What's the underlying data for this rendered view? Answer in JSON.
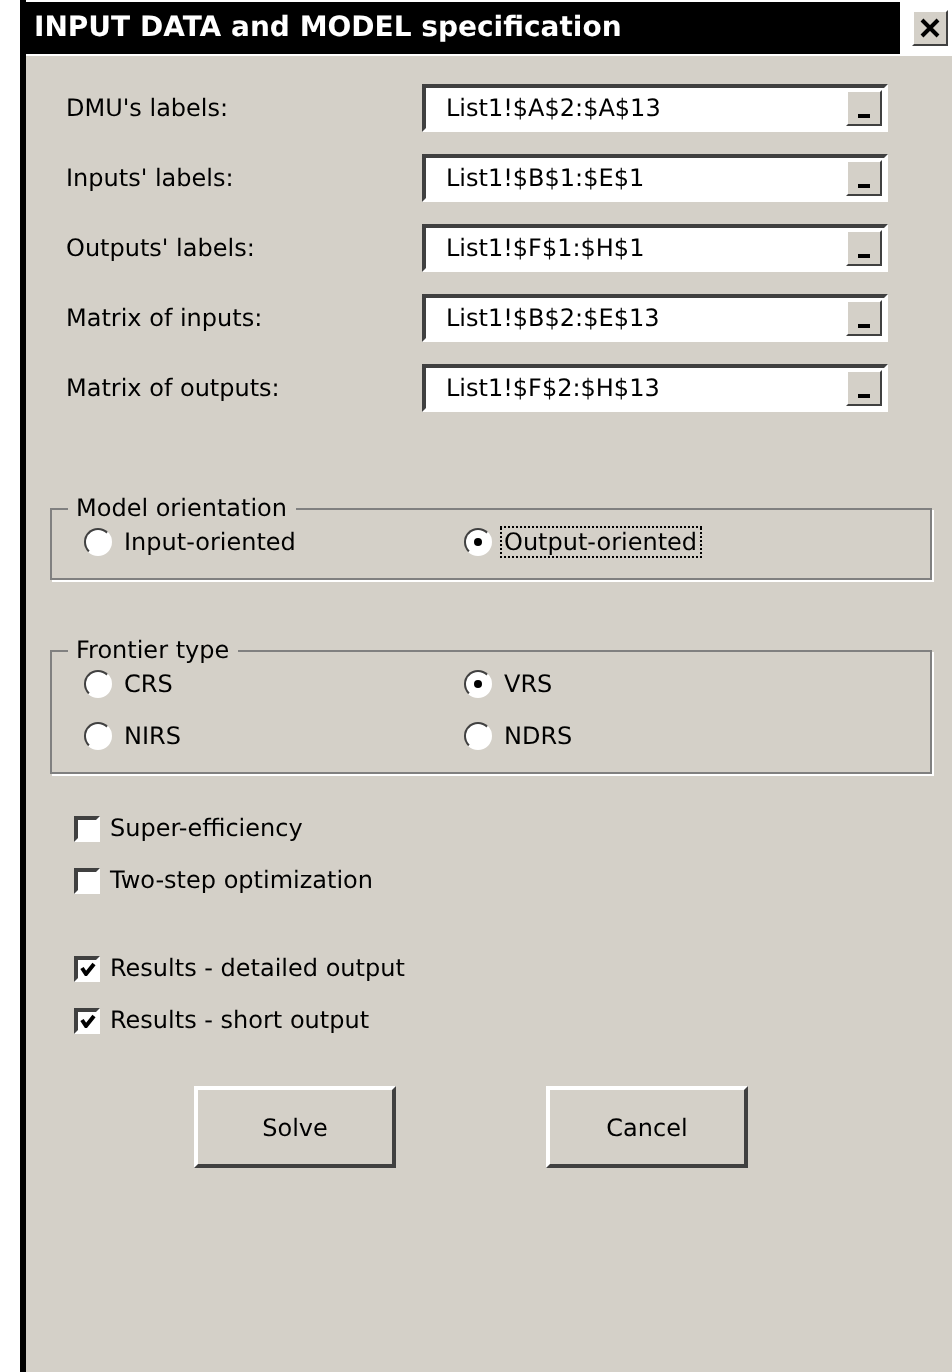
{
  "window": {
    "title": "INPUT DATA and MODEL specification"
  },
  "fields": [
    {
      "label": "DMU's labels:",
      "value": "List1!$A$2:$A$13"
    },
    {
      "label": "Inputs' labels:",
      "value": "List1!$B$1:$E$1"
    },
    {
      "label": "Outputs' labels:",
      "value": "List1!$F$1:$H$1"
    },
    {
      "label": "Matrix of inputs:",
      "value": "List1!$B$2:$E$13"
    },
    {
      "label": "Matrix of outputs:",
      "value": "List1!$F$2:$H$13"
    }
  ],
  "groups": [
    {
      "title": "Model orientation",
      "options": [
        {
          "label": "Input-oriented",
          "selected": false,
          "focused": false
        },
        {
          "label": "Output-oriented",
          "selected": true,
          "focused": true
        }
      ]
    },
    {
      "title": "Frontier type",
      "options": [
        {
          "label": "CRS",
          "selected": false,
          "focused": false
        },
        {
          "label": "VRS",
          "selected": true,
          "focused": false
        },
        {
          "label": "NIRS",
          "selected": false,
          "focused": false
        },
        {
          "label": "NDRS",
          "selected": false,
          "focused": false
        }
      ]
    }
  ],
  "checkbox_groups": [
    [
      {
        "label": "Super-efficiency",
        "checked": false
      },
      {
        "label": "Two-step optimization",
        "checked": false
      }
    ],
    [
      {
        "label": "Results - detailed output",
        "checked": true
      },
      {
        "label": "Results - short output",
        "checked": true
      }
    ]
  ],
  "buttons": [
    "Solve",
    "Cancel"
  ]
}
